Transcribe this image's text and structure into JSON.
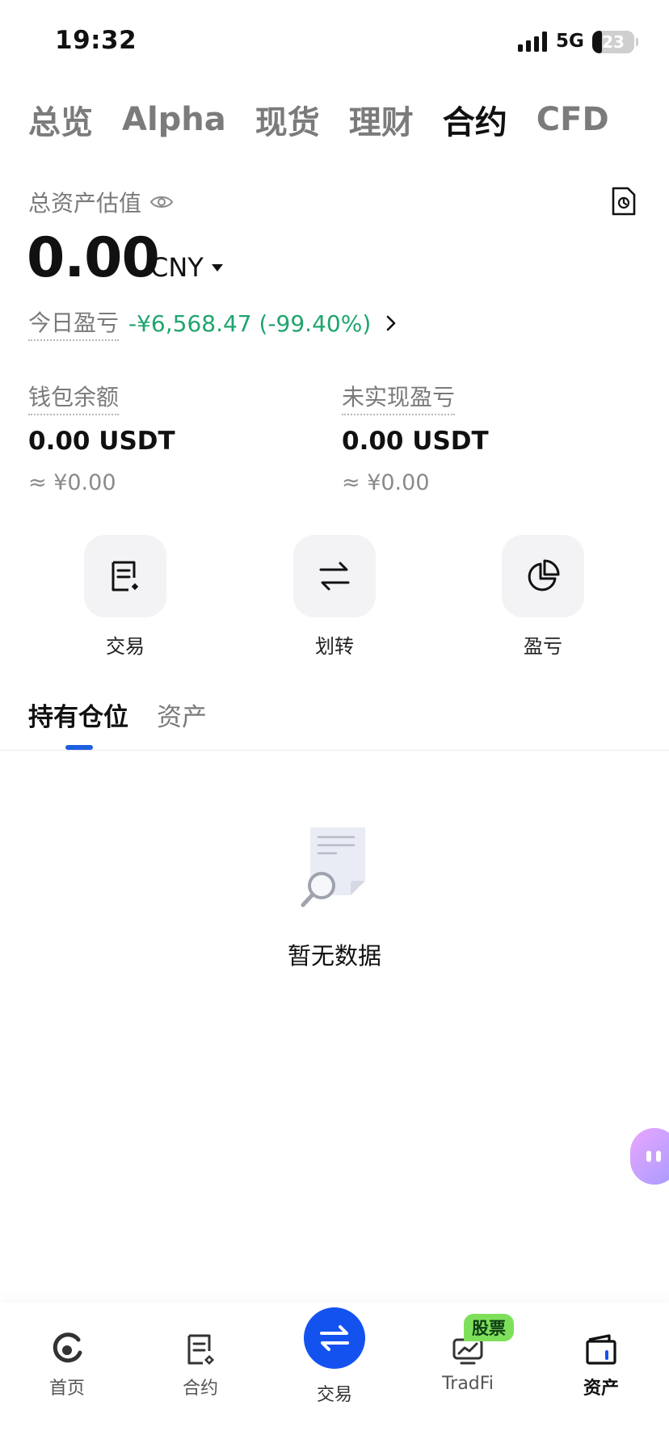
{
  "status_bar": {
    "time": "19:32",
    "network": "5G",
    "battery": "23"
  },
  "top_tabs": [
    {
      "label": "总览",
      "active": false
    },
    {
      "label": "Alpha",
      "active": false
    },
    {
      "label": "现货",
      "active": false
    },
    {
      "label": "理财",
      "active": false
    },
    {
      "label": "合约",
      "active": true
    },
    {
      "label": "CFD",
      "active": false
    }
  ],
  "summary": {
    "estimate_label": "总资产估值",
    "total_value": "0.00",
    "currency": "CNY",
    "today_pnl_label": "今日盈亏",
    "today_pnl_value": "-¥6,568.47 (-99.40%)"
  },
  "balances": {
    "wallet": {
      "label": "钱包余额",
      "value": "0.00 USDT",
      "approx": "≈ ¥0.00"
    },
    "unrealized": {
      "label": "未实现盈亏",
      "value": "0.00 USDT",
      "approx": "≈ ¥0.00"
    }
  },
  "actions": [
    {
      "label": "交易",
      "icon": "trade-icon"
    },
    {
      "label": "划转",
      "icon": "transfer-icon"
    },
    {
      "label": "盈亏",
      "icon": "pie-chart-icon"
    }
  ],
  "content_tabs": [
    {
      "label": "持有仓位",
      "active": true
    },
    {
      "label": "资产",
      "active": false
    }
  ],
  "empty_state": {
    "text": "暂无数据"
  },
  "bottom_nav": {
    "items": [
      {
        "label": "首页",
        "icon": "home-icon"
      },
      {
        "label": "合约",
        "icon": "contract-icon"
      },
      {
        "label": "交易",
        "icon": "swap-icon"
      },
      {
        "label": "TradFi",
        "icon": "tradfi-icon",
        "badge": "股票"
      },
      {
        "label": "资产",
        "icon": "wallet-icon",
        "active": true
      }
    ]
  },
  "colors": {
    "profit_loss": "#1fa56e",
    "accent": "#1452f0",
    "badge": "#7ee05a"
  }
}
